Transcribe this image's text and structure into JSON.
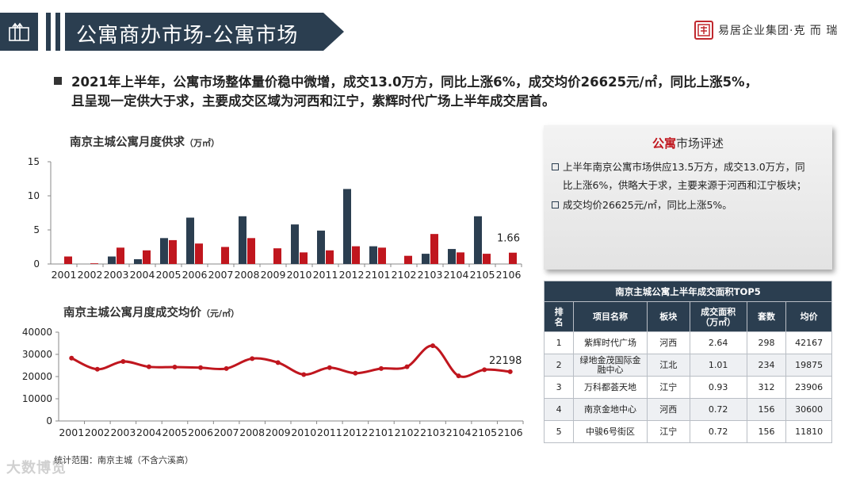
{
  "header": {
    "title": "公寓商办市场-公寓市场",
    "logo_text": "易居企业集团·克 而 瑞",
    "logo_seal": "易居"
  },
  "summary": {
    "line1": "2021年上半年，公寓市场整体量价稳中微增，成交13.0万方，同比上涨6%，成交均价26625元/㎡，同比上涨5%，",
    "line2": "且呈现一定供大于求，主要成交区域为河西和江宁，紫辉时代广场上半年成交居首。"
  },
  "chart1": {
    "title": "南京主城公寓月度供求",
    "unit": "（万㎡）"
  },
  "chart2": {
    "title": "南京主城公寓月度成交均价",
    "unit": "（元/㎡）"
  },
  "colors": {
    "navy": "#2b3e50",
    "red": "#c0161e",
    "line": "#c0161e"
  },
  "chart_data": [
    {
      "type": "bar",
      "categories": [
        "2001",
        "2002",
        "2003",
        "2004",
        "2005",
        "2006",
        "2007",
        "2008",
        "2009",
        "2010",
        "2011",
        "2012",
        "2101",
        "2102",
        "2103",
        "2104",
        "2105",
        "2106"
      ],
      "series": [
        {
          "values": [
            0,
            0,
            1.1,
            0.7,
            3.8,
            6.8,
            0,
            7.0,
            0,
            5.8,
            4.9,
            11.0,
            2.6,
            0,
            1.5,
            2.2,
            7.0,
            0
          ]
        },
        {
          "values": [
            1.1,
            0.1,
            2.4,
            2.0,
            3.5,
            3.0,
            2.5,
            3.8,
            2.3,
            1.7,
            2.0,
            2.6,
            2.4,
            1.2,
            4.4,
            1.7,
            1.5,
            1.66
          ]
        }
      ],
      "ylim": [
        0,
        15
      ],
      "yticks": [
        0,
        5,
        10,
        15
      ],
      "data_labels": [
        {
          "index": 17,
          "text": "1.66"
        }
      ],
      "grid": false
    },
    {
      "type": "line",
      "categories": [
        "2001",
        "2002",
        "2003",
        "2004",
        "2005",
        "2006",
        "2007",
        "2008",
        "2009",
        "2010",
        "2011",
        "2012",
        "2101",
        "2102",
        "2103",
        "2104",
        "2105",
        "2106"
      ],
      "series": [
        {
          "values": [
            28300,
            23300,
            26800,
            24400,
            24300,
            24000,
            23600,
            28100,
            26300,
            20900,
            24000,
            21500,
            23600,
            24400,
            33900,
            20300,
            23100,
            22198
          ]
        }
      ],
      "ylim": [
        0,
        40000
      ],
      "yticks": [
        0,
        10000,
        20000,
        30000,
        40000
      ],
      "data_labels": [
        {
          "index": 17,
          "text": "22198"
        }
      ],
      "grid": false
    }
  ],
  "review": {
    "title_highlight": "公寓",
    "title_rest": "市场评述",
    "item1_line1": "上半年南京公寓市场供应13.5万方，成交13.0万方，同",
    "item1_line2": "比上涨6%，供略大于求，主要来源于河西和江宁板块；",
    "item2": "成交均价26625元/㎡，同比上涨5%。"
  },
  "table": {
    "caption": "南京主城公寓上半年成交面积TOP5",
    "headers": [
      "排名",
      "项目名称",
      "板块",
      "成交面积（万㎡）",
      "套数",
      "均价"
    ],
    "rows": [
      [
        "1",
        "紫辉时代广场",
        "河西",
        "2.64",
        "298",
        "42167"
      ],
      [
        "2",
        "绿地金茂国际金融中心",
        "江北",
        "1.01",
        "234",
        "19875"
      ],
      [
        "3",
        "万科都荟天地",
        "江宁",
        "0.93",
        "312",
        "23906"
      ],
      [
        "4",
        "南京金地中心",
        "河西",
        "0.72",
        "156",
        "30600"
      ],
      [
        "5",
        "中骏6号街区",
        "江宁",
        "0.72",
        "156",
        "11810"
      ]
    ]
  },
  "footnote": "统计范围：南京主城（不含六溪高）",
  "watermark": "大数博览"
}
